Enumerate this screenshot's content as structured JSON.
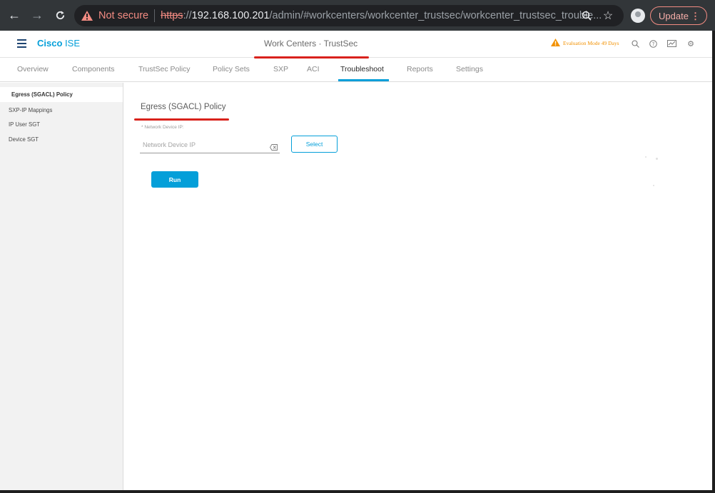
{
  "browser": {
    "security_label": "Not secure",
    "url_protocol": "https",
    "url_sep": "://",
    "url_host": "192.168.100.201",
    "url_path": "/admin/#workcenters/workcenter_trustsec/workcenter_trustsec_trouble...",
    "update_label": "Update",
    "update_menu": "⋮",
    "icons": {
      "back": "←",
      "forward": "→",
      "reload": "C",
      "zoom": "⊖",
      "star": "☆"
    }
  },
  "header": {
    "brand_bold": "Cisco",
    "brand_product": "ISE",
    "page_heading": "Work Centers · TrustSec",
    "evaluation": "Evaluation Mode 49 Days",
    "icons": {
      "search": "⚲",
      "help": "?",
      "dashboard": "▭",
      "settings": "⚙"
    }
  },
  "tabs": [
    {
      "label": "Overview"
    },
    {
      "label": "Components"
    },
    {
      "label": "TrustSec Policy"
    },
    {
      "label": "Policy Sets"
    },
    {
      "label": "SXP"
    },
    {
      "label": "ACI"
    },
    {
      "label": "Troubleshoot",
      "active": true
    },
    {
      "label": "Reports"
    },
    {
      "label": "Settings"
    }
  ],
  "sidebar": {
    "items": [
      {
        "label": "Egress (SGACL) Policy",
        "active": true
      },
      {
        "label": "SXP-IP Mappings"
      },
      {
        "label": "IP User SGT"
      },
      {
        "label": "Device SGT"
      }
    ]
  },
  "form": {
    "title": "Egress (SGACL) Policy",
    "field_label": "* Network Device IP:",
    "field_value": "",
    "field_placeholder": "Network Device IP",
    "select_label": "Select",
    "run_label": "Run"
  },
  "colors": {
    "accent": "#049fd9",
    "warning": "#f29100",
    "annotation": "#d9221c"
  }
}
